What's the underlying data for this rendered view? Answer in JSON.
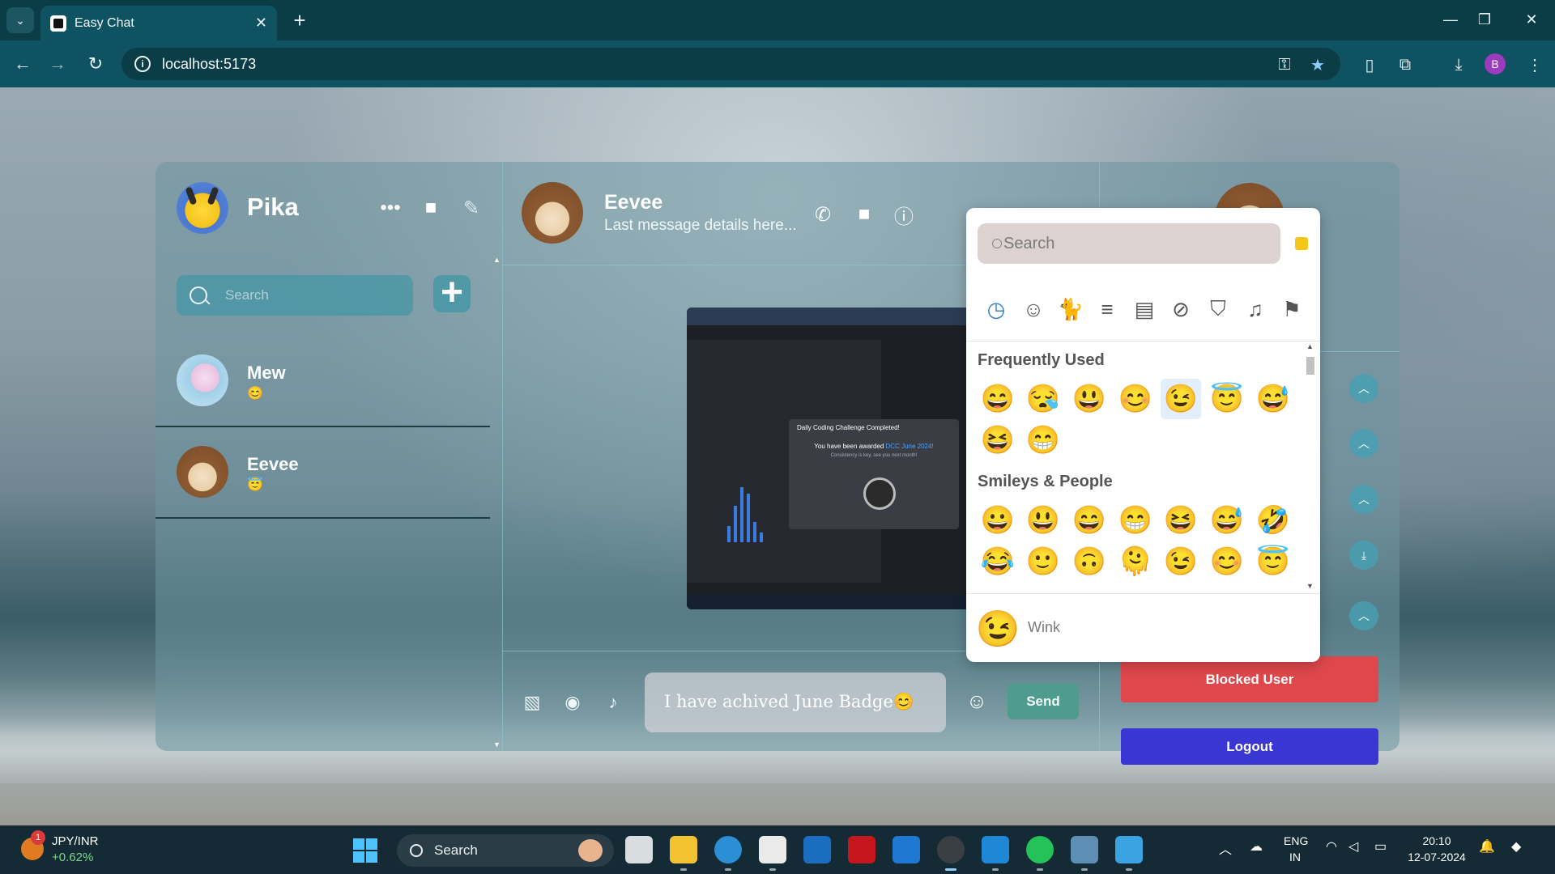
{
  "browser": {
    "tab_title": "Easy Chat",
    "url": "localhost:5173",
    "profile_initial": "B"
  },
  "sidebar": {
    "user_name": "Pika",
    "search_placeholder": "Search",
    "add_label": "+",
    "contacts": [
      {
        "name": "Mew",
        "last": "😊"
      },
      {
        "name": "Eevee",
        "last": "😇"
      }
    ]
  },
  "chat": {
    "contact_name": "Eevee",
    "subtitle": "Last message details here...",
    "image_toast": {
      "title": "Daily Coding Challenge Completed!",
      "line1": "You have been awarded ",
      "line1_highlight": "DCC June 2024!",
      "line2": "Consistency is key, see you next month!"
    },
    "composer_text": "I have achived June Badge😊",
    "send_label": "Send"
  },
  "details": {
    "blocked_label": "Blocked User",
    "logout_label": "Logout"
  },
  "emoji_picker": {
    "search_placeholder": "Search",
    "sections": {
      "frequently_used": "Frequently Used",
      "smileys_people": "Smileys & People"
    },
    "frequently_used": [
      "😄",
      "😪",
      "😃",
      "😊",
      "😉",
      "😇",
      "😅",
      "😆",
      "😁"
    ],
    "smileys_row1": [
      "😀",
      "😃",
      "😄",
      "😁",
      "😆",
      "😅",
      "🤣"
    ],
    "smileys_row2": [
      "😂",
      "🙂",
      "🙃",
      "🫠",
      "😉",
      "😊",
      "😇"
    ],
    "preview_emoji": "😉",
    "preview_name": "Wink"
  },
  "taskbar": {
    "ticker_badge": "1",
    "ticker_name": "JPY/INR",
    "ticker_change": "+0.62%",
    "search_label": "Search",
    "lang_top": "ENG",
    "lang_bottom": "IN",
    "time": "20:10",
    "date": "12-07-2024"
  },
  "colors": {
    "accent_teal": "#4f9c8e",
    "blocked_red": "#e0474c",
    "logout_blue": "#3a36d4",
    "browser_chrome": "#0f5261"
  }
}
